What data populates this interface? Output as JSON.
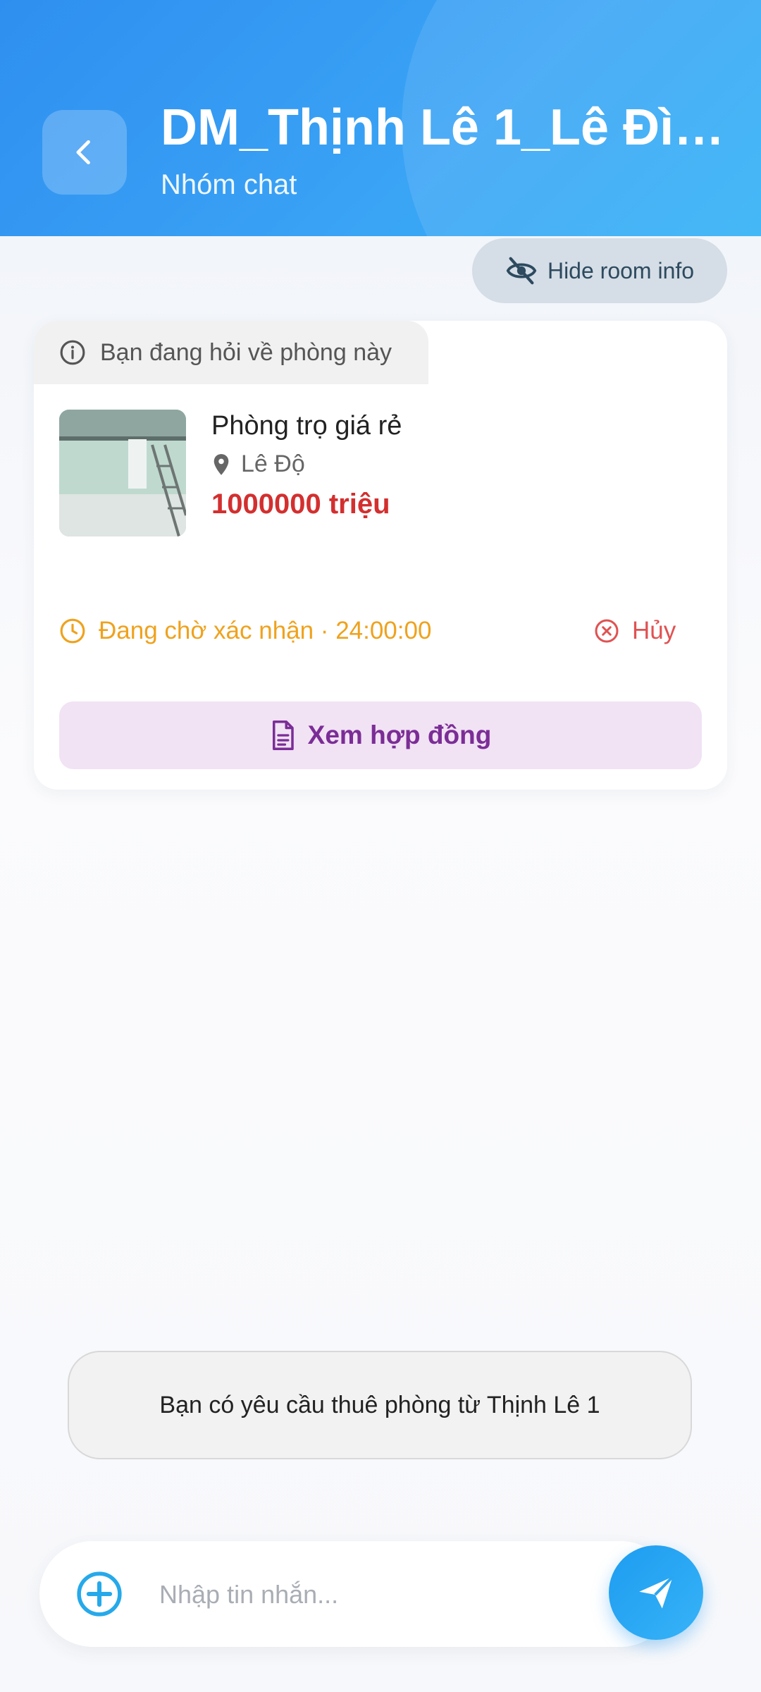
{
  "header": {
    "title": "DM_Thịnh Lê 1_Lê Đìn...",
    "subtitle": "Nhóm chat"
  },
  "room_info_toggle": {
    "label": "Hide room info",
    "icon": "eye-off-icon"
  },
  "room_card": {
    "asking_label": "Bạn đang hỏi về phòng này",
    "room_name": "Phòng trọ giá rẻ",
    "location": "Lê Độ",
    "price": "1000000 triệu",
    "status_text": "Đang chờ xác nhận · 24:00:00",
    "cancel_label": "Hủy",
    "contract_button": "Xem hợp đồng"
  },
  "system_message": "Bạn có yêu cầu thuê phòng từ Thịnh Lê 1",
  "composer": {
    "placeholder": "Nhập tin nhắn...",
    "add_icon": "plus-circle-icon",
    "send_icon": "send-icon"
  },
  "colors": {
    "header_blue": "#2f8ff0",
    "price_red": "#d32f2f",
    "status_amber": "#efa21d",
    "cancel_red": "#e05252",
    "contract_purple": "#7b2d96"
  }
}
